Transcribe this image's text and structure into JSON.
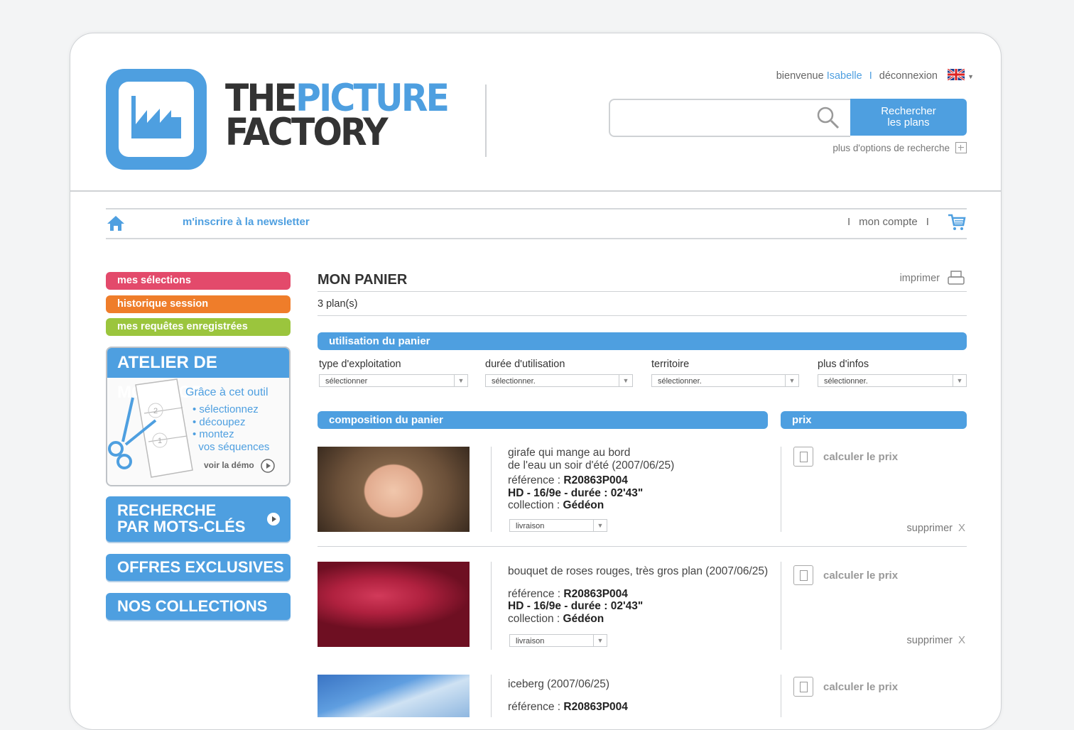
{
  "brand": {
    "logo_text_part1": "THE",
    "logo_text_part2": "PICTURE",
    "logo_text_part3": "FACTORY",
    "color_blue": "#4e9fe0"
  },
  "header": {
    "welcome": "bienvenue",
    "user": "Isabelle",
    "logout": "déconnexion",
    "language_flag": "uk-flag-icon",
    "search_placeholder": "",
    "search_button": "Rechercher les plans",
    "more_options": "plus d'options de recherche"
  },
  "nav": {
    "newsletter": "m'inscrire à la newsletter",
    "account": "mon compte",
    "sep": "I"
  },
  "sidebar": {
    "pills": [
      {
        "label": "mes sélections",
        "color": "#e34a6b"
      },
      {
        "label": "historique session",
        "color": "#ef7d2a"
      },
      {
        "label": "mes requêtes enregistrées",
        "color": "#9bc53d"
      }
    ],
    "atelier": {
      "title": "ATELIER DE MONTAGE",
      "subtitle": "Grâce à cet outil",
      "bullets": [
        "sélectionnez",
        "découpez",
        "montez"
      ],
      "bullet_cont": "vos séquences",
      "demo": "voir la démo"
    },
    "keyword_search": {
      "line1": "RECHERCHE",
      "line2": "PAR MOTS-CLÉS"
    },
    "offers": "OFFRES EXCLUSIVES !",
    "collections": "NOS COLLECTIONS"
  },
  "main": {
    "title": "MON PANIER",
    "print": "imprimer",
    "count": "3 plan(s)",
    "usage_bar": "utilisation du panier",
    "filters": [
      {
        "label": "type d'exploitation",
        "value": "sélectionner"
      },
      {
        "label": "durée d'utilisation",
        "value": "sélectionner."
      },
      {
        "label": "territoire",
        "value": "sélectionner."
      },
      {
        "label": "plus d'infos",
        "value": "sélectionner."
      }
    ],
    "composition_bar": "composition du panier",
    "price_bar": "prix",
    "calc_label": "calculer le prix",
    "delete_label": "supprimer",
    "delete_x": "X",
    "delivery_value": "livraison",
    "ref_label": "référence : ",
    "collection_label": "collection : ",
    "items": [
      {
        "title1": "girafe qui mange au bord",
        "title2": "de l'eau un soir d'été (2007/06/25)",
        "ref": "R20863P004",
        "spec": "HD - 16/9e - durée : 02'43\"",
        "collection": "Gédéon"
      },
      {
        "title1": "bouquet de roses rouges, très gros plan (2007/06/25)",
        "title2": "",
        "ref": "R20863P004",
        "spec": "HD - 16/9e - durée : 02'43\"",
        "collection": "Gédéon"
      },
      {
        "title1": "iceberg (2007/06/25)",
        "title2": "",
        "ref": "R20863P004"
      }
    ]
  }
}
